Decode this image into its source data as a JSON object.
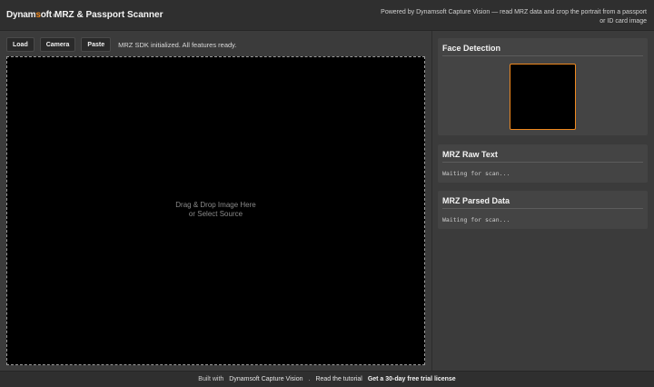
{
  "header": {
    "logo_prefix": "Dynam",
    "logo_accent": "s",
    "logo_suffix": "oft",
    "logo_mark": "®",
    "title": "MRZ & Passport Scanner",
    "description": "Powered by Dynamsoft Capture Vision — read MRZ data and crop the portrait from a passport or ID card image"
  },
  "toolbar": {
    "load_label": "Load",
    "camera_label": "Camera",
    "paste_label": "Paste",
    "status": "MRZ SDK initialized. All features ready."
  },
  "viewer": {
    "hint_line1": "Drag & Drop Image Here",
    "hint_line2": "or Select Source"
  },
  "panels": {
    "face": {
      "title": "Face Detection"
    },
    "raw": {
      "title": "MRZ Raw Text",
      "body": "Waiting for scan..."
    },
    "parsed": {
      "title": "MRZ Parsed Data",
      "body": "Waiting for scan..."
    }
  },
  "footer": {
    "built_with": "Built with",
    "product_link": "Dynamsoft Capture Vision",
    "separator": ".",
    "tutorial_link": "Read the tutorial",
    "license_link": "Get a 30-day free trial license"
  },
  "colors": {
    "accent": "#f0891f",
    "background": "#3b3b3b",
    "panel": "#444444",
    "viewer": "#000000"
  }
}
